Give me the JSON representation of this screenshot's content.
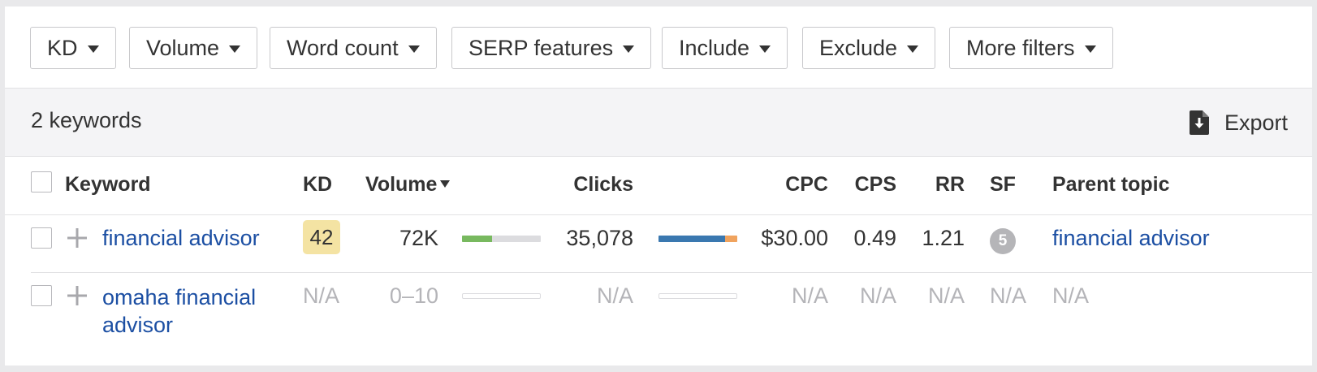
{
  "filters": [
    {
      "label": "KD"
    },
    {
      "label": "Volume"
    },
    {
      "label": "Word count"
    },
    {
      "label": "SERP features"
    },
    {
      "label": "Include"
    },
    {
      "label": "Exclude"
    },
    {
      "label": "More filters"
    }
  ],
  "summary": {
    "keyword_count": "2 keywords",
    "export_label": "Export"
  },
  "columns": {
    "keyword": "Keyword",
    "kd": "KD",
    "volume": "Volume",
    "clicks": "Clicks",
    "cpc": "CPC",
    "cps": "CPS",
    "rr": "RR",
    "sf": "SF",
    "parent_topic": "Parent topic"
  },
  "sorted_column": "volume",
  "rows": [
    {
      "keyword": "financial advisor",
      "kd": "42",
      "kd_color": "#f4e3a3",
      "volume": "72K",
      "volume_bar_fraction": 0.38,
      "clicks": "35,078",
      "clicks_organic_fraction": 0.85,
      "clicks_paid_fraction": 0.15,
      "cpc": "$30.00",
      "cps": "0.49",
      "rr": "1.21",
      "sf": "5",
      "parent_topic": "financial advisor"
    },
    {
      "keyword_line1": "omaha financial",
      "keyword_line2": "advisor",
      "kd": "N/A",
      "volume": "0–10",
      "clicks": "N/A",
      "cpc": "N/A",
      "cps": "N/A",
      "rr": "N/A",
      "sf": "N/A",
      "parent_topic": "N/A"
    }
  ],
  "colors": {
    "link": "#1c4fa3",
    "volume_bar_fill": "#78b95f",
    "clicks_organic": "#3a78b0",
    "clicks_paid": "#f0a35e",
    "kd_badge": "#f4e3a3"
  },
  "icons": {
    "export": "download-doc-icon",
    "add": "plus-icon",
    "dropdown": "caret-down-icon",
    "sort": "sort-desc-icon"
  }
}
